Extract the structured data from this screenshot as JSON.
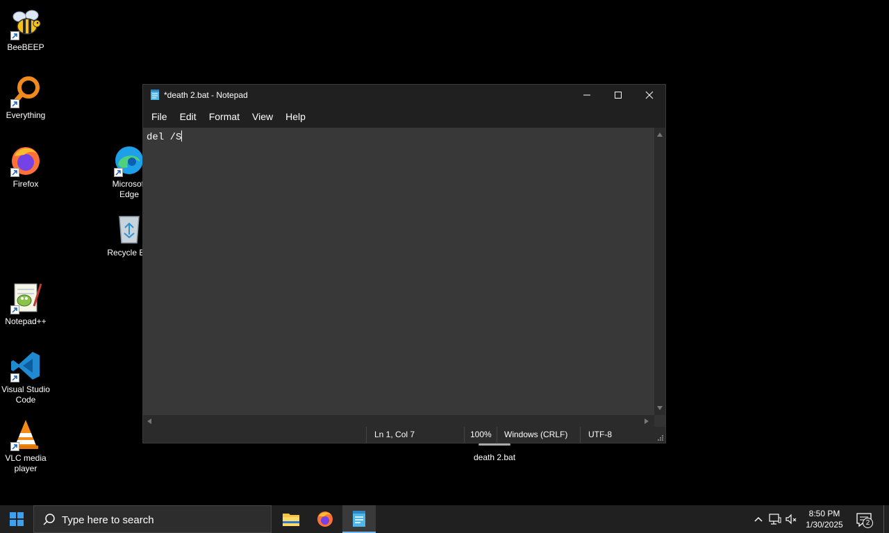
{
  "desktop": {
    "icons": [
      {
        "label": "BeeBEEP",
        "icon": "bee-icon"
      },
      {
        "label": "Everything",
        "icon": "everything-search-icon"
      },
      {
        "label": "Firefox",
        "icon": "firefox-icon"
      },
      {
        "label": "Microsoft\nEdge",
        "icon": "edge-icon"
      },
      {
        "label": "Recycle Bin",
        "icon": "recycle-bin-icon"
      },
      {
        "label": "Notepad++",
        "icon": "notepad-plus-plus-icon"
      },
      {
        "label": "Visual Studio\nCode",
        "icon": "vscode-icon"
      },
      {
        "label": "VLC media\nplayer",
        "icon": "vlc-icon"
      }
    ]
  },
  "notepad": {
    "title": "*death 2.bat - Notepad",
    "menu": [
      "File",
      "Edit",
      "Format",
      "View",
      "Help"
    ],
    "content": "del /S",
    "status": {
      "position": "Ln 1, Col 7",
      "zoom": "100%",
      "line_ending": "Windows (CRLF)",
      "encoding": "UTF-8"
    }
  },
  "desktop_file": {
    "label": "death 2.bat"
  },
  "taskbar": {
    "search_placeholder": "Type here to search",
    "apps": [
      {
        "name": "file-explorer",
        "icon": "folder-icon"
      },
      {
        "name": "firefox",
        "icon": "firefox-icon"
      },
      {
        "name": "notepad",
        "icon": "notepad-icon",
        "active": true
      }
    ],
    "time": "8:50 PM",
    "date": "1/30/2025",
    "notification_count": "2"
  },
  "colors": {
    "accent": "#76b9ed",
    "window_bg": "#202020",
    "editor_bg": "#383838"
  }
}
